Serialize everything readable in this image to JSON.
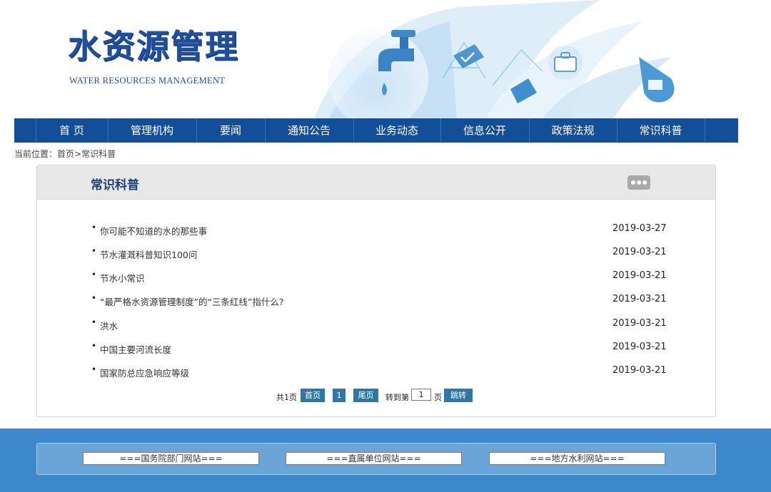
{
  "header": {
    "logo_cn": "水资源管理",
    "logo_en": "WATER RESOURCES MANAGEMENT"
  },
  "nav": {
    "items": [
      {
        "label": "首 页"
      },
      {
        "label": "管理机构"
      },
      {
        "label": "要闻"
      },
      {
        "label": "通知公告"
      },
      {
        "label": "业务动态"
      },
      {
        "label": "信息公开"
      },
      {
        "label": "政策法规"
      },
      {
        "label": "常识科普"
      }
    ]
  },
  "breadcrumb": {
    "prefix": "当前位置：",
    "home": "首页",
    "separator": ">",
    "current": "常识科普"
  },
  "panel": {
    "title": "常识科普",
    "more_icon": "more-dots-icon",
    "items": [
      {
        "title": "你可能不知道的水的那些事",
        "date": "2019-03-27"
      },
      {
        "title": "节水灌溉科普知识100问",
        "date": "2019-03-21"
      },
      {
        "title": "节水小常识",
        "date": "2019-03-21"
      },
      {
        "title": "“最严格水资源管理制度”的“三条红线”指什么?",
        "date": "2019-03-21"
      },
      {
        "title": "洪水",
        "date": "2019-03-21"
      },
      {
        "title": "中国主要河流长度",
        "date": "2019-03-21"
      },
      {
        "title": "国家防总应急响应等级",
        "date": "2019-03-21"
      }
    ]
  },
  "pager": {
    "total": "共1页",
    "first": "首页",
    "current": "1",
    "last": "尾页",
    "goto_prefix": "转到第",
    "goto_value": "1",
    "goto_suffix": "页",
    "jump": "跳转"
  },
  "footer": {
    "links": [
      {
        "label": "===国务院部门网站==="
      },
      {
        "label": "===直属单位网站==="
      },
      {
        "label": "===地方水利网站==="
      }
    ]
  },
  "colors": {
    "nav_bg": "#134f99",
    "footer_bg": "#3c88cb",
    "pager_btn": "#2e78a6",
    "title": "#1b3f7a"
  }
}
